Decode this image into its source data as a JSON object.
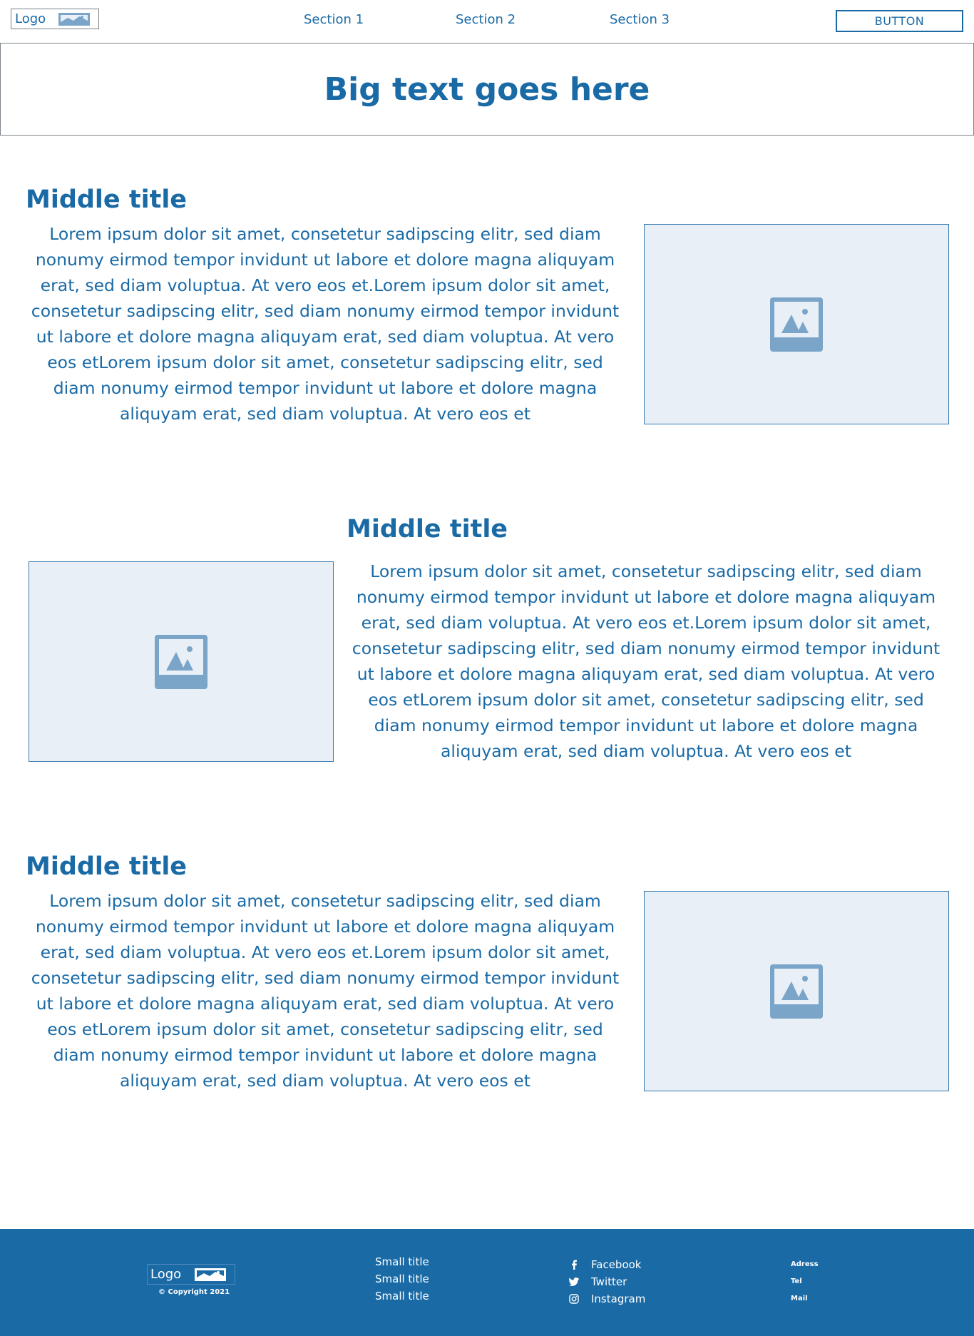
{
  "header": {
    "logo_label": "Logo",
    "nav": [
      "Section 1",
      "Section 2",
      "Section 3"
    ],
    "button_label": "BUTTON"
  },
  "hero": {
    "title": "Big text goes here"
  },
  "sections": [
    {
      "title": "Middle title",
      "body": "Lorem ipsum dolor sit amet, consetetur sadipscing elitr, sed diam nonumy eirmod tempor invidunt ut labore et dolore magna aliquyam erat, sed diam voluptua. At vero eos et.Lorem ipsum dolor sit amet, consetetur sadipscing elitr, sed diam nonumy eirmod tempor invidunt ut labore et dolore magna aliquyam erat, sed diam voluptua. At vero eos etLorem ipsum dolor sit amet, consetetur sadipscing elitr, sed diam nonumy eirmod tempor invidunt ut labore et dolore magna aliquyam erat, sed diam voluptua. At vero eos et"
    },
    {
      "title": "Middle title",
      "body": "Lorem ipsum dolor sit amet, consetetur sadipscing elitr, sed diam nonumy eirmod tempor invidunt ut labore et dolore magna aliquyam erat, sed diam voluptua. At vero eos et.Lorem ipsum dolor sit amet, consetetur sadipscing elitr, sed diam nonumy eirmod tempor invidunt ut labore et dolore magna aliquyam erat, sed diam voluptua. At vero eos etLorem ipsum dolor sit amet, consetetur sadipscing elitr, sed diam nonumy eirmod tempor invidunt ut labore et dolore magna aliquyam erat, sed diam voluptua. At vero eos et"
    },
    {
      "title": "Middle title",
      "body": "Lorem ipsum dolor sit amet, consetetur sadipscing elitr, sed diam nonumy eirmod tempor invidunt ut labore et dolore magna aliquyam erat, sed diam voluptua. At vero eos et.Lorem ipsum dolor sit amet, consetetur sadipscing elitr, sed diam nonumy eirmod tempor invidunt ut labore et dolore magna aliquyam erat, sed diam voluptua. At vero eos etLorem ipsum dolor sit amet, consetetur sadipscing elitr, sed diam nonumy eirmod tempor invidunt ut labore et dolore magna aliquyam erat, sed diam voluptua. At vero eos et"
    }
  ],
  "footer": {
    "logo_label": "Logo",
    "copyright": "© Copyright 2021",
    "links": [
      "Small title",
      "Small title",
      "Small title"
    ],
    "social": [
      {
        "icon": "facebook-icon",
        "label": "Facebook"
      },
      {
        "icon": "twitter-icon",
        "label": "Twitter"
      },
      {
        "icon": "instagram-icon",
        "label": "Instagram"
      }
    ],
    "contact": [
      "Adress",
      "Tel",
      "Mail"
    ]
  },
  "colors": {
    "brand": "#1a6aa6",
    "image_placeholder_bg": "#e8eff7",
    "image_placeholder_icon": "#7aa4c8",
    "footer_bg": "#1a6aa6"
  }
}
